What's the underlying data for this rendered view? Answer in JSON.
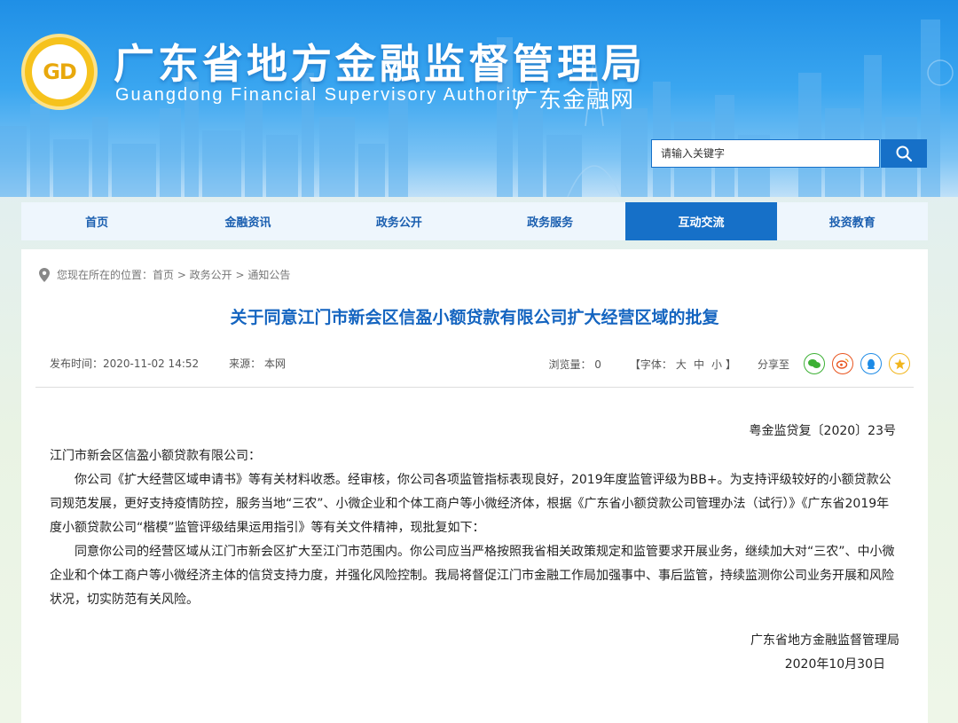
{
  "header": {
    "logo_text": "GD",
    "title": "广东省地方金融监督管理局",
    "subtitle": "Guangdong Financial Supervisory Authority",
    "site_name": "广东金融网"
  },
  "search": {
    "placeholder": "请输入关键字",
    "button_icon": "search-icon"
  },
  "nav": {
    "items": [
      {
        "label": "首页"
      },
      {
        "label": "金融资讯"
      },
      {
        "label": "政务公开"
      },
      {
        "label": "政务服务"
      },
      {
        "label": "互动交流",
        "active": true
      },
      {
        "label": "投资教育"
      }
    ]
  },
  "breadcrumb": {
    "icon": "location-pin-icon",
    "text": "您现在所在的位置：首页 > 政务公开 > 通知公告"
  },
  "article": {
    "title": "关于同意江门市新会区信盈小额贷款有限公司扩大经营区域的批复",
    "publish_time": "发布时间：2020-11-02 14:52",
    "source": "来源： 本网",
    "views": "浏览量： 0",
    "font_label_open": "【字体：",
    "font_large": "大",
    "font_medium": "中",
    "font_small": "小",
    "font_label_close": "】",
    "share_label": "分享至",
    "share_icons": [
      "wechat-icon",
      "weibo-icon",
      "qq-icon",
      "qzone-icon"
    ],
    "doc_number": "粤金监贷复〔2020〕23号",
    "recipient": "江门市新会区信盈小额贷款有限公司：",
    "paragraph1": "你公司《扩大经营区域申请书》等有关材料收悉。经审核，你公司各项监管指标表现良好，2019年度监管评级为BB+。为支持评级较好的小额贷款公司规范发展，更好支持疫情防控，服务当地“三农”、小微企业和个体工商户等小微经济体，根据《广东省小额贷款公司管理办法（试行）》《广东省2019年度小额贷款公司“楷模”监管评级结果运用指引》等有关文件精神，现批复如下：",
    "paragraph2": "同意你公司的经营区域从江门市新会区扩大至江门市范围内。你公司应当严格按照我省相关政策规定和监管要求开展业务，继续加大对“三农”、中小微企业和个体工商户等小微经济主体的信贷支持力度，并强化风险控制。我局将督促江门市金融工作局加强事中、事后监管，持续监测你公司业务开展和风险状况，切实防范有关风险。",
    "signature": "广东省地方金融监督管理局",
    "date": "2020年10月30日"
  },
  "colors": {
    "accent": "#1670c8",
    "title_blue": "#1565c0",
    "logo_gold": "#f6c21c"
  }
}
